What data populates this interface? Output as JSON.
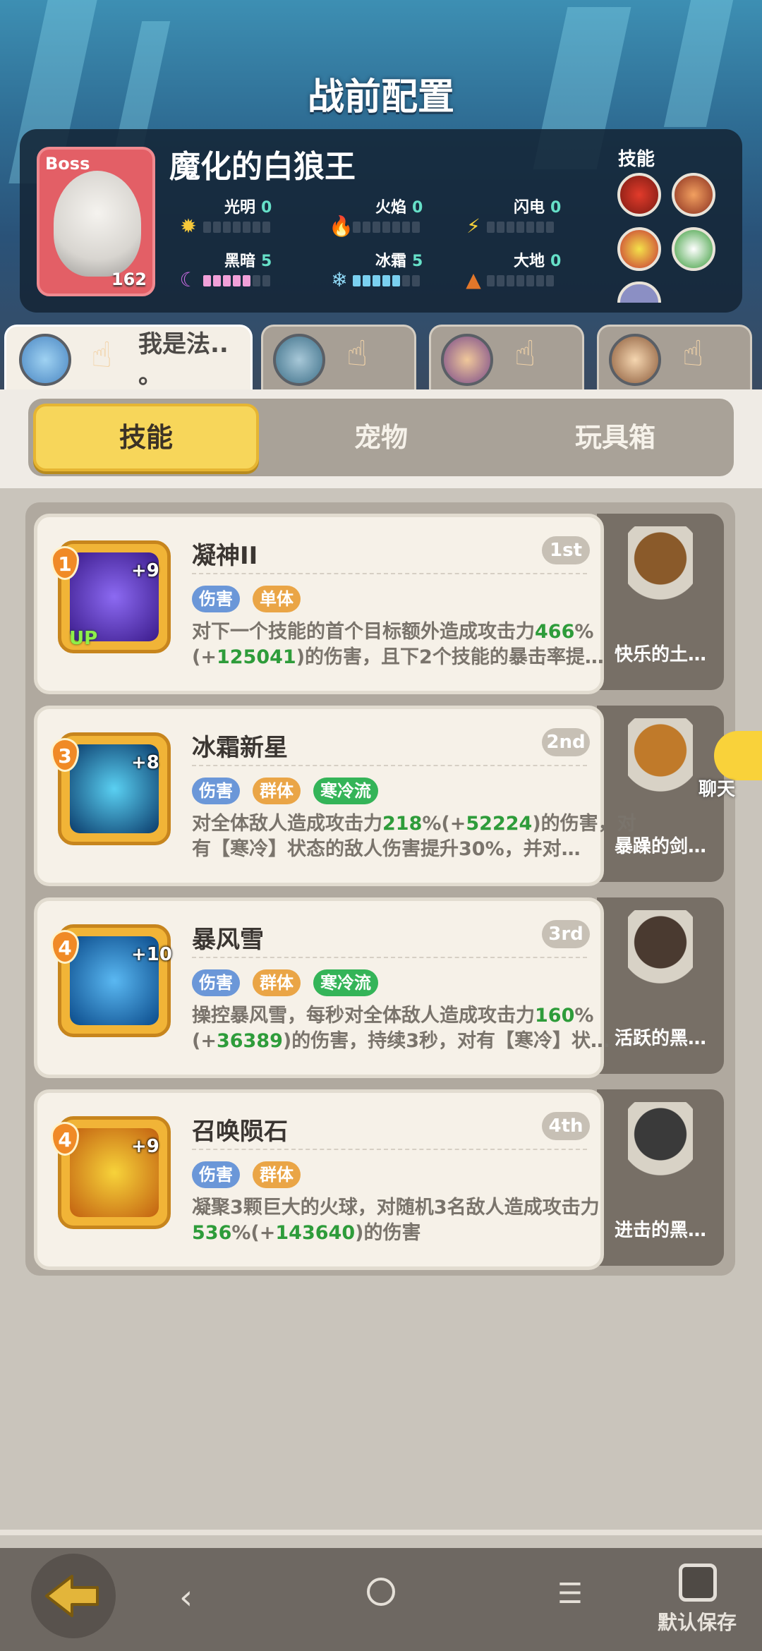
{
  "page_title": "战前配置",
  "boss": {
    "tag": "Boss",
    "name": "魔化的白狼王",
    "level": "162",
    "elements": [
      {
        "label": "光明",
        "value": "0",
        "filled": 0,
        "icon": "sun-icon"
      },
      {
        "label": "火焰",
        "value": "0",
        "filled": 0,
        "icon": "fire-icon"
      },
      {
        "label": "闪电",
        "value": "0",
        "filled": 0,
        "icon": "lightning-icon"
      },
      {
        "label": "黑暗",
        "value": "5",
        "filled": 5,
        "icon": "moon-icon"
      },
      {
        "label": "冰霜",
        "value": "5",
        "filled": 5,
        "icon": "snowflake-icon"
      },
      {
        "label": "大地",
        "value": "0",
        "filled": 0,
        "icon": "earth-icon"
      }
    ],
    "skills_title": "技能"
  },
  "heroes": [
    {
      "name": "我是法..\n。",
      "active": true
    },
    {
      "name": "",
      "active": false
    },
    {
      "name": "",
      "active": false
    },
    {
      "name": "",
      "active": false
    }
  ],
  "tabs": [
    "技能",
    "宠物",
    "玩具箱"
  ],
  "skills": [
    {
      "name": "凝神II",
      "rank": "1st",
      "level": "1",
      "plus": "+9",
      "up": "UP",
      "tags": [
        {
          "text": "伤害",
          "c": "t-blue"
        },
        {
          "text": "单体",
          "c": "t-orange"
        }
      ],
      "desc_a": "对下一个技能的首个目标额外造成攻击力",
      "n1": "466",
      "desc_b": "%(+",
      "n2": "125041",
      "desc_c": ")的伤害，且下2个技能的暴击率提…",
      "pet": "快乐的土…"
    },
    {
      "name": "冰霜新星",
      "rank": "2nd",
      "level": "3",
      "plus": "+8",
      "up": "",
      "tags": [
        {
          "text": "伤害",
          "c": "t-blue"
        },
        {
          "text": "群体",
          "c": "t-orange"
        },
        {
          "text": "寒冷流",
          "c": "t-green"
        }
      ],
      "desc_a": "对全体敌人造成攻击力",
      "n1": "218",
      "desc_b": "%(+",
      "n2": "52224",
      "desc_c": ")的伤害，对有【寒冷】状态的敌人伤害提升30%，并对…",
      "pet": "暴躁的剑…"
    },
    {
      "name": "暴风雪",
      "rank": "3rd",
      "level": "4",
      "plus": "+10",
      "up": "",
      "tags": [
        {
          "text": "伤害",
          "c": "t-blue"
        },
        {
          "text": "群体",
          "c": "t-orange"
        },
        {
          "text": "寒冷流",
          "c": "t-green"
        }
      ],
      "desc_a": "操控暴风雪，每秒对全体敌人造成攻击力",
      "n1": "160",
      "desc_b": "%(+",
      "n2": "36389",
      "desc_c": ")的伤害，持续3秒，对有【寒冷】状…",
      "pet": "活跃的黑…"
    },
    {
      "name": "召唤陨石",
      "rank": "4th",
      "level": "4",
      "plus": "+9",
      "up": "",
      "tags": [
        {
          "text": "伤害",
          "c": "t-blue"
        },
        {
          "text": "群体",
          "c": "t-orange"
        }
      ],
      "desc_a": "凝聚3颗巨大的火球，对随机3名敌人造成攻击力",
      "n1": "536",
      "desc_b": "%(+",
      "n2": "143640",
      "desc_c": ")的伤害",
      "pet": "进击的黑…"
    }
  ],
  "chat_label": "聊天",
  "save_label": "默认保存"
}
